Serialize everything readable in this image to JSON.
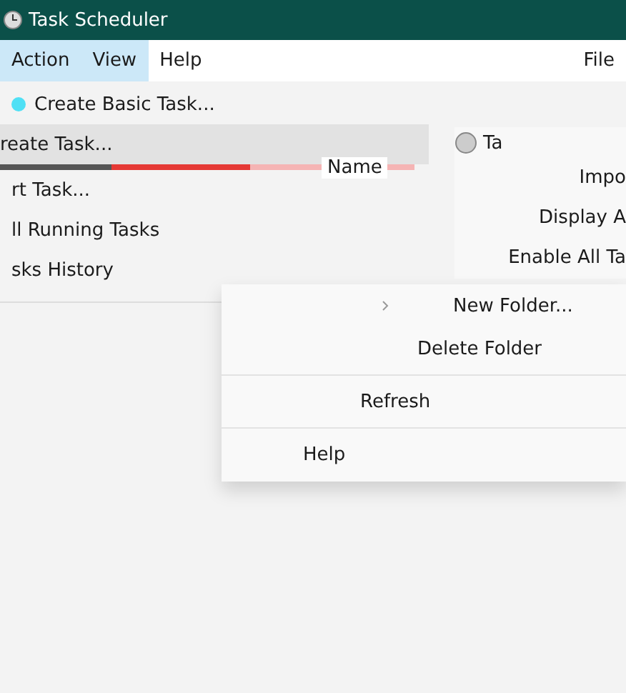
{
  "window": {
    "title": "Task Scheduler"
  },
  "menubar": [
    {
      "label": "Action",
      "selected": true
    },
    {
      "label": "View",
      "selected": true
    },
    {
      "label": "Help",
      "selected": false
    }
  ],
  "menubar_right": "File",
  "action_menu": [
    {
      "label": "Create Basic Task...",
      "selected": false,
      "icon": true
    },
    {
      "label": "reate Task...",
      "selected": true,
      "icon": false
    },
    {
      "label": "rt Task...",
      "selected": false,
      "icon": false
    },
    {
      "label": "ll Running Tasks",
      "selected": false,
      "icon": false
    },
    {
      "label": "sks History",
      "selected": false,
      "icon": false
    }
  ],
  "pane": {
    "item": "Ta",
    "column": "Name"
  },
  "actions_pane": [
    "Impo",
    "Display A",
    "Enable All Ta"
  ],
  "context_menu": [
    {
      "label": "New Folder...",
      "submenu": true
    },
    {
      "label": "Delete Folder",
      "submenu": false
    },
    {
      "label": "Refresh",
      "submenu": false
    },
    {
      "label": "Help",
      "submenu": false
    }
  ]
}
